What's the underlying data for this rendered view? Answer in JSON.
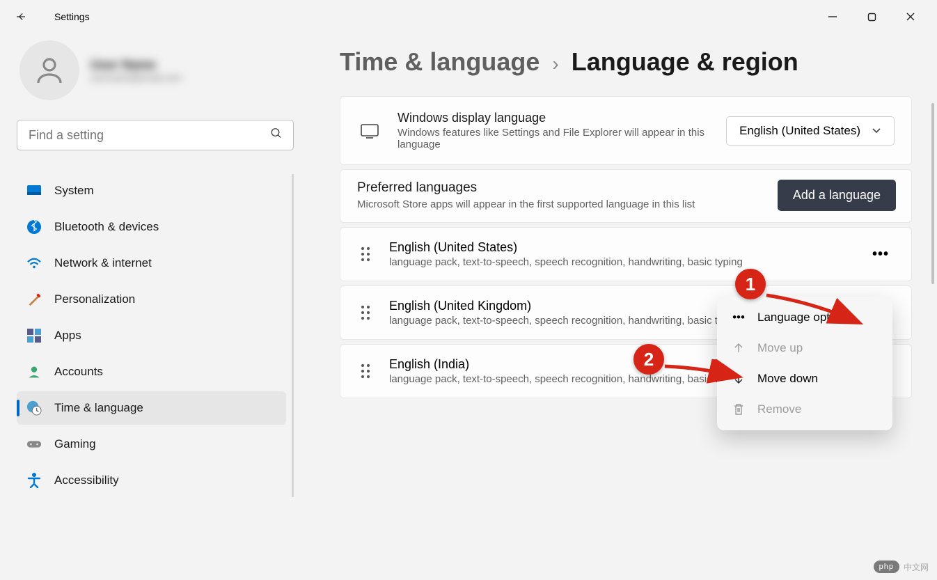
{
  "window": {
    "title": "Settings"
  },
  "user": {
    "name": "User Name",
    "email": "username@email.com"
  },
  "search": {
    "placeholder": "Find a setting"
  },
  "sidebar": {
    "items": [
      {
        "label": "System"
      },
      {
        "label": "Bluetooth & devices"
      },
      {
        "label": "Network & internet"
      },
      {
        "label": "Personalization"
      },
      {
        "label": "Apps"
      },
      {
        "label": "Accounts"
      },
      {
        "label": "Time & language"
      },
      {
        "label": "Gaming"
      },
      {
        "label": "Accessibility"
      }
    ]
  },
  "breadcrumb": {
    "parent": "Time & language",
    "separator": "›",
    "current": "Language & region"
  },
  "display_lang": {
    "title": "Windows display language",
    "subtitle": "Windows features like Settings and File Explorer will appear in this language",
    "selected": "English (United States)"
  },
  "preferred": {
    "title": "Preferred languages",
    "subtitle": "Microsoft Store apps will appear in the first supported language in this list",
    "add_label": "Add a language",
    "items": [
      {
        "name": "English (United States)",
        "features": "language pack, text-to-speech, speech recognition, handwriting, basic typing"
      },
      {
        "name": "English (United Kingdom)",
        "features": "language pack, text-to-speech, speech recognition, handwriting, basic typing"
      },
      {
        "name": "English (India)",
        "features": "language pack, text-to-speech, speech recognition, handwriting, basic typing"
      }
    ]
  },
  "context_menu": {
    "options": "Language options",
    "move_up": "Move up",
    "move_down": "Move down",
    "remove": "Remove"
  },
  "annotations": {
    "one": "1",
    "two": "2"
  },
  "watermark": {
    "brand": "php",
    "text": "中文网"
  }
}
